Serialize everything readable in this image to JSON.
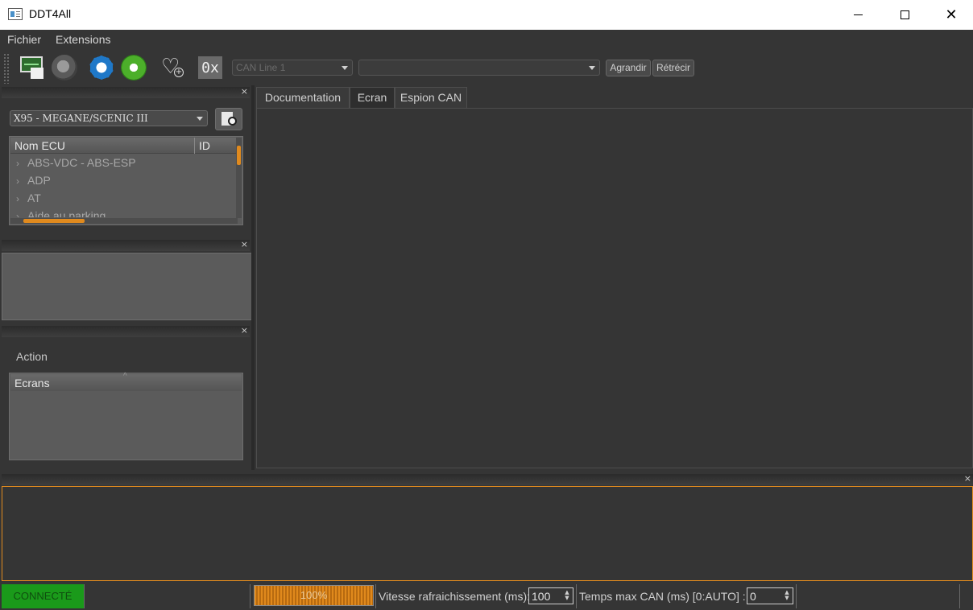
{
  "window": {
    "title": "DDT4All"
  },
  "menu": [
    "Fichier",
    "Extensions"
  ],
  "toolbar": {
    "can_line": "CAN Line 1",
    "ecu_select": "",
    "hex_label": "0x",
    "grow_label": "Agrandir",
    "shrink_label": "Rétrécir"
  },
  "ecu_panel": {
    "vehicle": "X95 - MEGANE/SCENIC III",
    "columns": [
      "Nom ECU",
      "ID"
    ],
    "items": [
      "ABS-VDC - ABS-ESP",
      "ADP",
      "AT",
      "Aide au parking"
    ]
  },
  "actions": {
    "title": "Action",
    "list_header": "Ecrans"
  },
  "tabs": [
    "Documentation",
    "Ecran",
    "Espion CAN"
  ],
  "active_tab": 1,
  "status": {
    "connection": "CONNECTÉ",
    "progress_text": "100%",
    "progress": 1.0,
    "refresh_label": "Vitesse rafraichissement (ms):",
    "refresh_value": "100",
    "canmax_label": "Temps max CAN (ms) [0:AUTO] :",
    "canmax_value": "0"
  },
  "colors": {
    "accent": "#e08a1e",
    "connected": "#1a9a1a",
    "background": "#353535"
  }
}
